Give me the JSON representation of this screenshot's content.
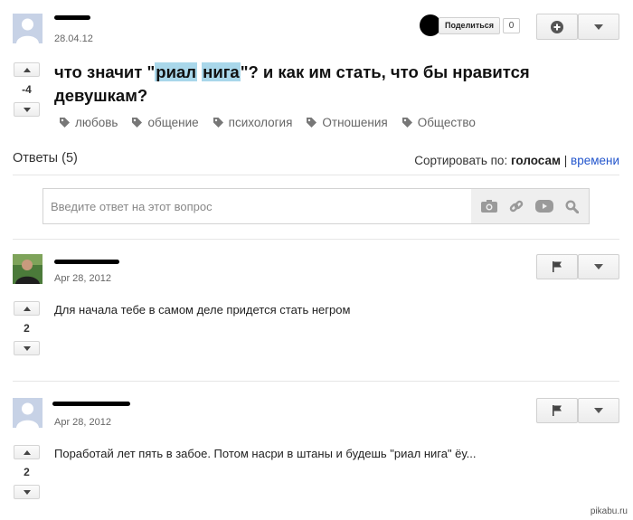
{
  "question": {
    "date": "28.04.12",
    "share_label": "Поделиться",
    "share_count": "0",
    "votes": "-4",
    "title_parts": {
      "before": "что значит \"",
      "highlight1": "риал",
      "space": " ",
      "highlight2": "нига",
      "after": "\"? и как им стать, что бы нравится девушкам?"
    },
    "tags": [
      "любовь",
      "общение",
      "психология",
      "Отношения",
      "Общество"
    ]
  },
  "answers_section": {
    "heading": "Ответы (5)",
    "sort_label": "Сортировать по:",
    "sort_active": "голосам",
    "sort_separator": "|",
    "sort_other": "времени",
    "input_placeholder": "Введите ответ на этот вопрос",
    "input_value": ""
  },
  "answers": [
    {
      "date": "Apr 28, 2012",
      "votes": "2",
      "text": "Для начала тебе в самом деле придется стать негром"
    },
    {
      "date": "Apr 28, 2012",
      "votes": "2",
      "text": "Поработай лет пять в забое. Потом насри в штаны и будешь \"риал нига\" ёу..."
    }
  ],
  "watermark": "pikabu.ru",
  "icons": {
    "plus": "plus-icon",
    "dropdown": "chevron-down-icon",
    "flag": "flag-icon",
    "up": "arrow-up-icon",
    "down": "arrow-down-icon",
    "tag": "tag-icon",
    "camera": "camera-icon",
    "link": "link-icon",
    "video": "video-icon",
    "search": "search-icon"
  },
  "colors": {
    "highlight": "#a9d7ea",
    "link": "#2255cc",
    "avatar": "#c7d2e6"
  }
}
